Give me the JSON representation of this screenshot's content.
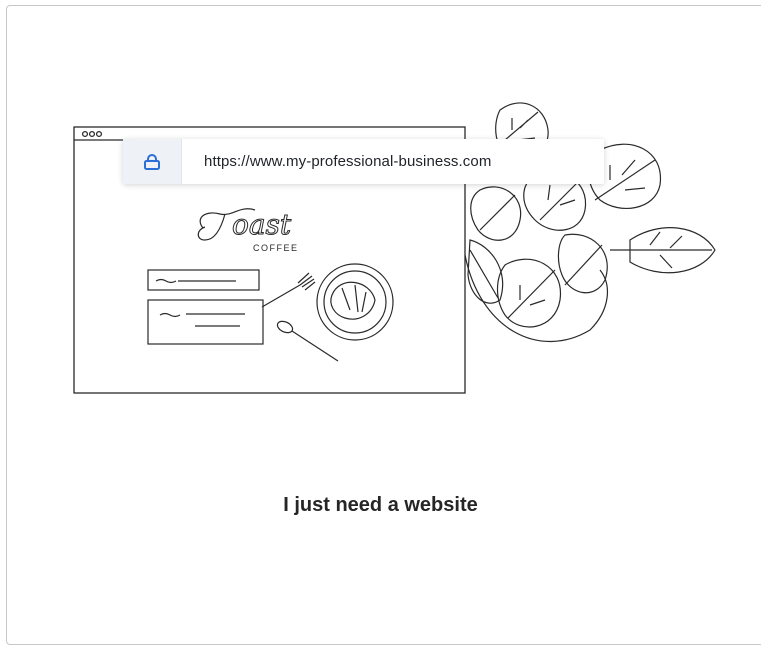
{
  "browser": {
    "url": "https://www.my-professional-business.com"
  },
  "mockup": {
    "brand_script": "Toast",
    "brand_sub": "COFFEE"
  },
  "option": {
    "label": "I just need a website"
  },
  "colors": {
    "lock_blue": "#2b6fd6",
    "line": "#2a2a2a"
  }
}
